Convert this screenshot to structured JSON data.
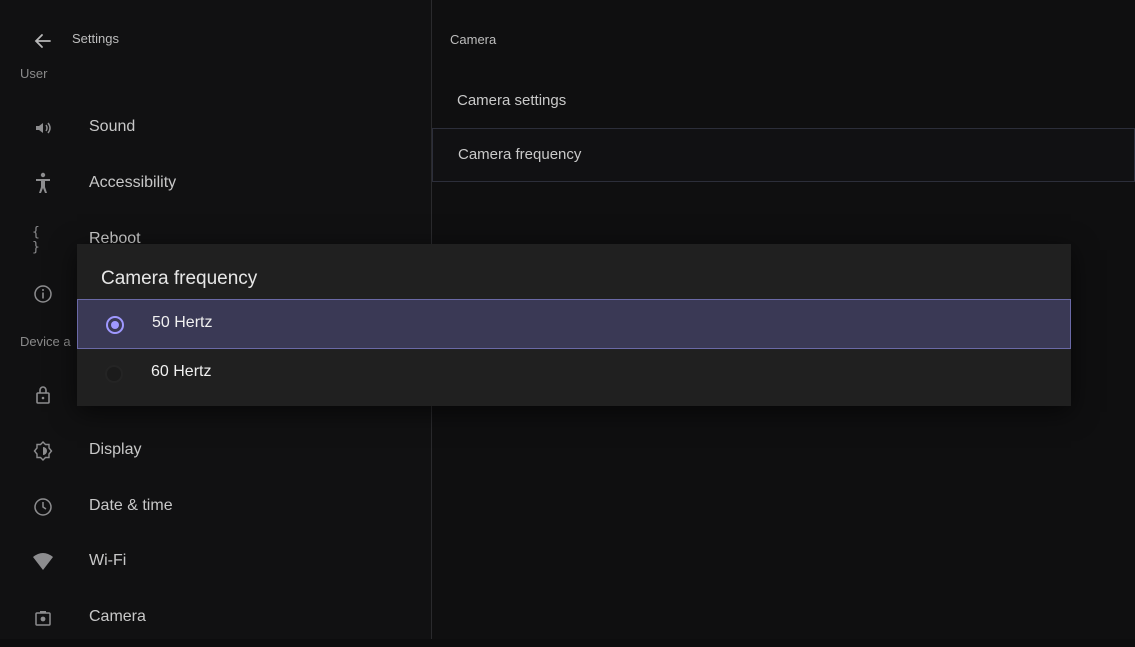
{
  "header": {
    "title": "Settings",
    "back_icon": "arrow-left-icon"
  },
  "sidebar": {
    "sections": [
      "User",
      "Device a"
    ],
    "items": [
      {
        "label": "Sound",
        "icon": "speaker-icon"
      },
      {
        "label": "Accessibility",
        "icon": "accessibility-icon"
      },
      {
        "label": "Reboot",
        "icon": "braces-icon"
      },
      {
        "label": "",
        "icon": "info-icon"
      },
      {
        "label": "",
        "icon": "lock-icon"
      },
      {
        "label": "Display",
        "icon": "brightness-icon"
      },
      {
        "label": "Date & time",
        "icon": "clock-icon"
      },
      {
        "label": "Wi-Fi",
        "icon": "wifi-icon"
      },
      {
        "label": "Camera",
        "icon": "camera-icon"
      }
    ]
  },
  "detail": {
    "title": "Camera",
    "items": [
      {
        "label": "Camera settings"
      },
      {
        "label": "Camera frequency",
        "selected": true
      }
    ]
  },
  "dialog": {
    "title": "Camera frequency",
    "options": [
      {
        "label": "50 Hertz",
        "selected": true
      },
      {
        "label": "60 Hertz",
        "selected": false
      }
    ]
  },
  "colors": {
    "accent": "#9f98ff",
    "selection_bg": "#3a3955",
    "dialog_bg": "#202020"
  }
}
